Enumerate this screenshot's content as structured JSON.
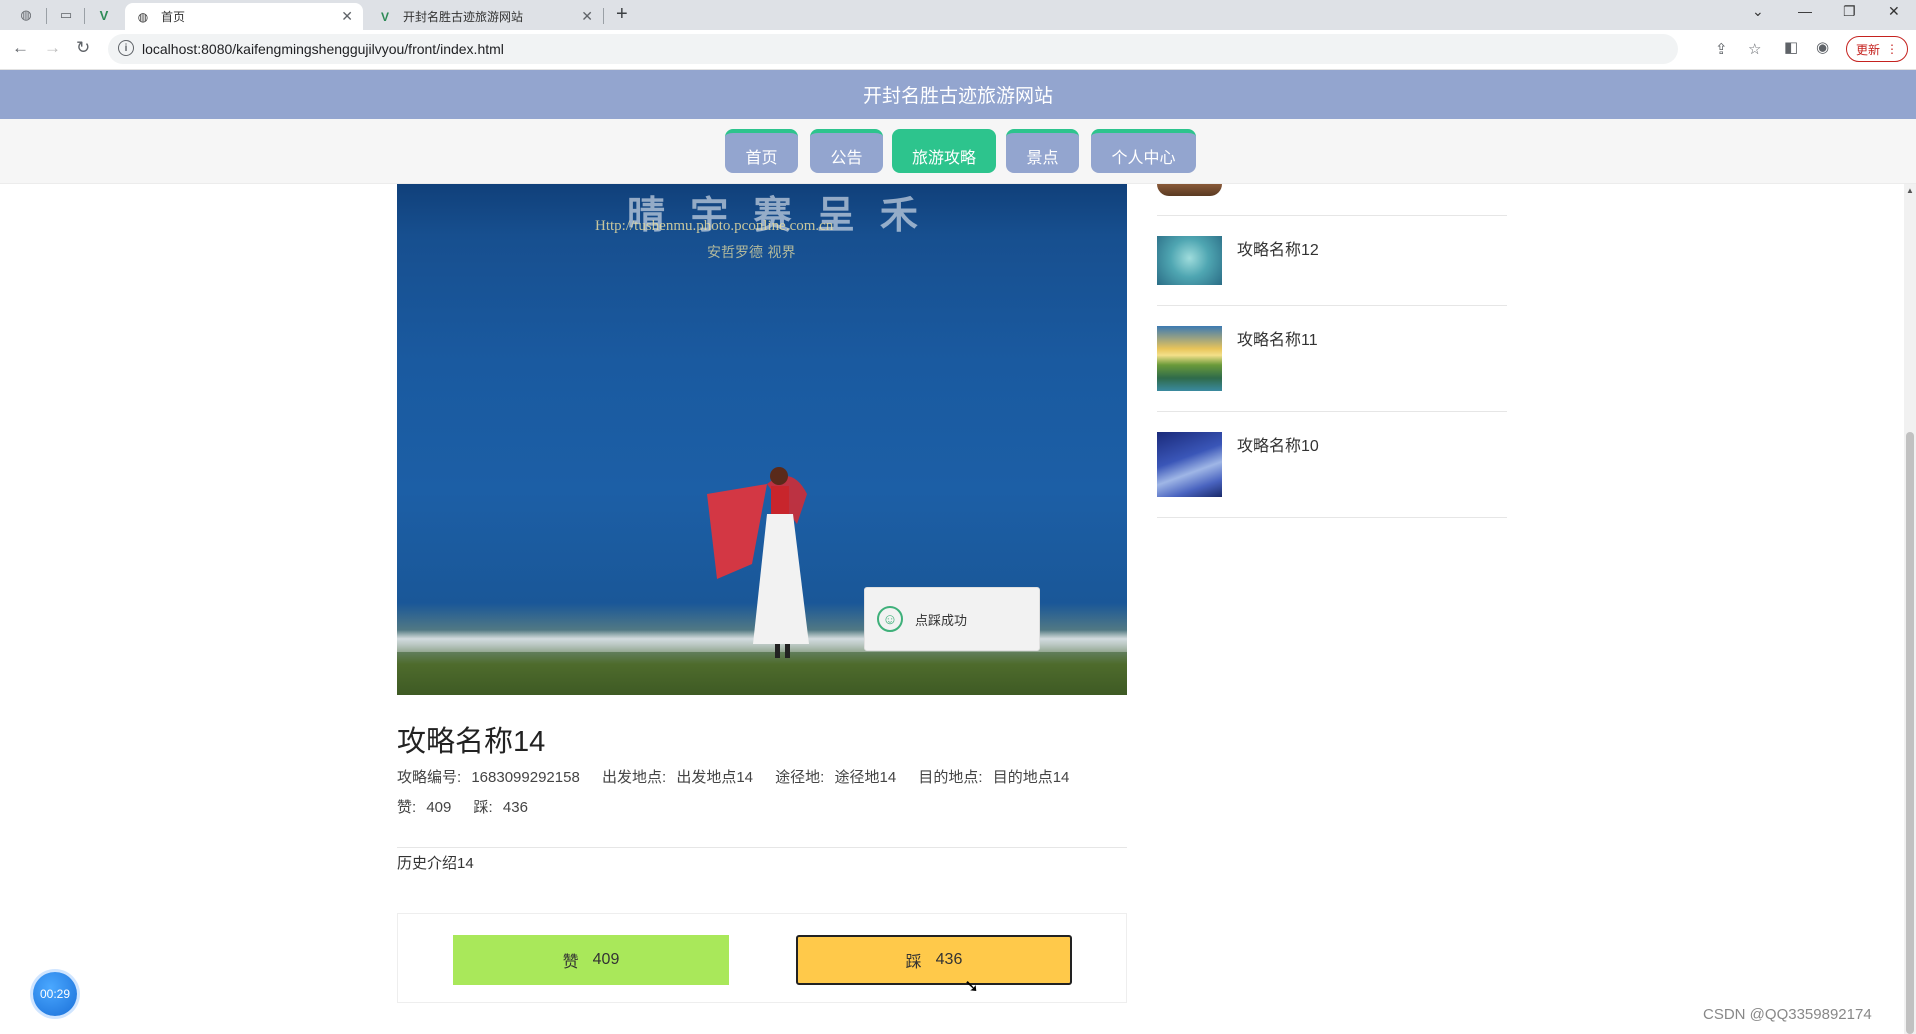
{
  "browser": {
    "tabs": [
      {
        "title": "首页",
        "active": true
      },
      {
        "title": "开封名胜古迹旅游网站",
        "active": false
      }
    ],
    "new_tab_glyph": "+",
    "url": "localhost:8080/kaifengmingshenggujilvyou/front/index.html",
    "update_label": "更新"
  },
  "site": {
    "title": "开封名胜古迹旅游网站",
    "nav": [
      {
        "label": "首页",
        "active": false
      },
      {
        "label": "公告",
        "active": false
      },
      {
        "label": "旅游攻略",
        "active": true
      },
      {
        "label": "景点",
        "active": false
      },
      {
        "label": "个人中心",
        "active": false
      }
    ]
  },
  "hero": {
    "watermark_chars": "晴 宇 赛 呈 禾",
    "watermark_url": "Http://tushenmu.photo.pconline.com.cn",
    "watermark_caption": "安哲罗德  视界"
  },
  "toast": {
    "message": "点踩成功",
    "icon": "smile-icon"
  },
  "article": {
    "title": "攻略名称14",
    "id_label": "攻略编号:",
    "id_value": "1683099292158",
    "start_label": "出发地点:",
    "start_value": "出发地点14",
    "via_label": "途径地:",
    "via_value": "途径地14",
    "dest_label": "目的地点:",
    "dest_value": "目的地点14",
    "like_label": "赞:",
    "like_value": "409",
    "dislike_label": "踩:",
    "dislike_value": "436",
    "intro": "历史介绍14"
  },
  "votes": {
    "like_label": "赞",
    "like_count": "409",
    "dislike_label": "踩",
    "dislike_count": "436",
    "like_color": "#a9e85a",
    "dislike_color": "#ffc94a"
  },
  "sidebar": {
    "items": [
      {
        "label": "攻略名称12"
      },
      {
        "label": "攻略名称11"
      },
      {
        "label": "攻略名称10"
      }
    ]
  },
  "overlay": {
    "timer": "00:29",
    "watermark": "CSDN @QQ3359892174"
  },
  "colors": {
    "header_bg": "#93a5cf",
    "accent_green": "#2dc48d"
  }
}
